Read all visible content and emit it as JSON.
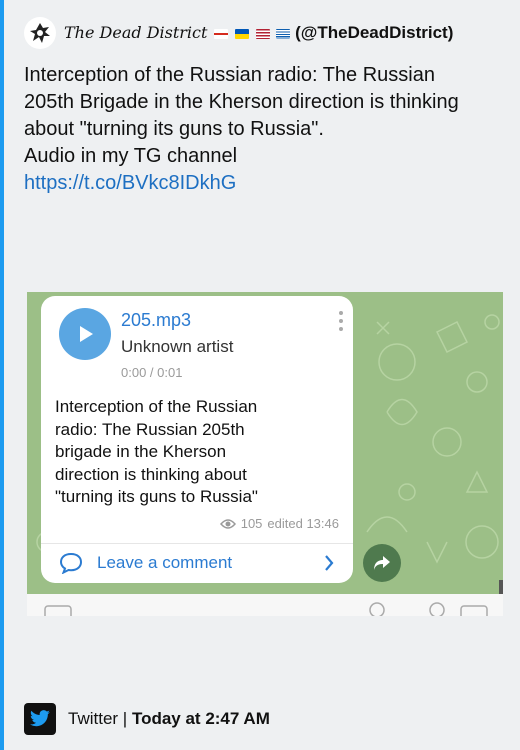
{
  "header": {
    "author_name": "The Dead District",
    "handle": "(@TheDeadDistrict)"
  },
  "tweet": {
    "line1": "Interception of the Russian radio: The Russian",
    "line2": "205th Brigade in the Kherson direction is thinking",
    "line3": "about \"turning its guns to Russia\".",
    "line4": "Audio in my TG channel",
    "link": "https://t.co/BVkc8IDkhG"
  },
  "media": {
    "file_name": "205.mp3",
    "artist": "Unknown artist",
    "time": "0:00 / 0:01",
    "body_line1": "Interception of the Russian",
    "body_line2": "radio: The Russian 205th",
    "body_line3": "brigade in the Kherson",
    "body_line4": "direction is thinking about",
    "body_line5": "\"turning its guns to Russia\"",
    "views": "105",
    "edited": "edited 13:46",
    "comment_label": "Leave a comment"
  },
  "footer": {
    "source": "Twitter",
    "separator": "|",
    "timestamp": "Today at 2:47 AM"
  },
  "colors": {
    "link": "#1d6fc2",
    "accent_bar": "#1d9bf0",
    "telegram_blue": "#5aa6e2",
    "chat_background": "#9cbf87"
  },
  "icons": [
    "avatar-logo-icon",
    "play-icon",
    "more-vert-icon",
    "eye-icon",
    "comment-bubble-icon",
    "chevron-right-icon",
    "share-arrow-icon",
    "twitter-bird-icon"
  ]
}
